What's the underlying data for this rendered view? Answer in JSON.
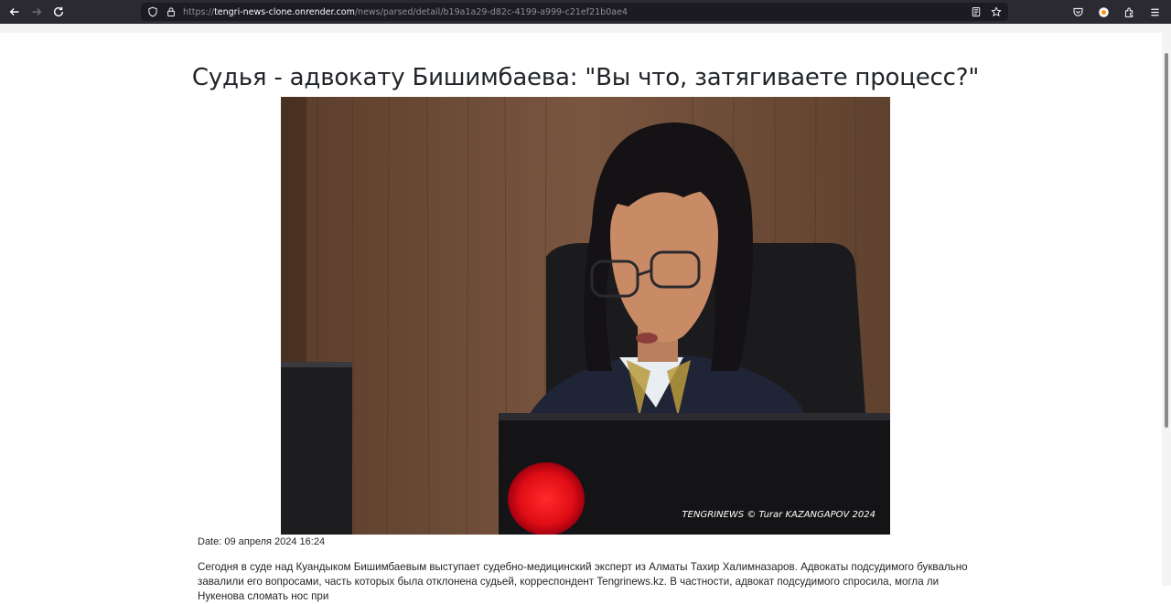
{
  "browser": {
    "url_prefix": "https://",
    "url_host": "tengri-news-clone.onrender.com",
    "url_path": "/news/parsed/detail/b19a1a29-d82c-4199-a999-c21ef21b0ae4"
  },
  "article": {
    "title": "Судья - адвокату Бишимбаева: \"Вы что, затягиваете процесс?\"",
    "image_caption": "TENGRINEWS © Turar KAZANGAPOV 2024",
    "date": "Date: 09 апреля 2024 16:24",
    "body": "Сегодня в суде над Куандыком Бишимбаевым выступает судебно-медицинский эксперт из Алматы Тахир Халимназаров. Адвокаты подсудимого буквально завалили его вопросами, часть которых была отклонена судьей, корреспондент Tengrinews.kz. В частности, адвокат подсудимого спросила, могла ли Нукенова сломать нос при"
  }
}
